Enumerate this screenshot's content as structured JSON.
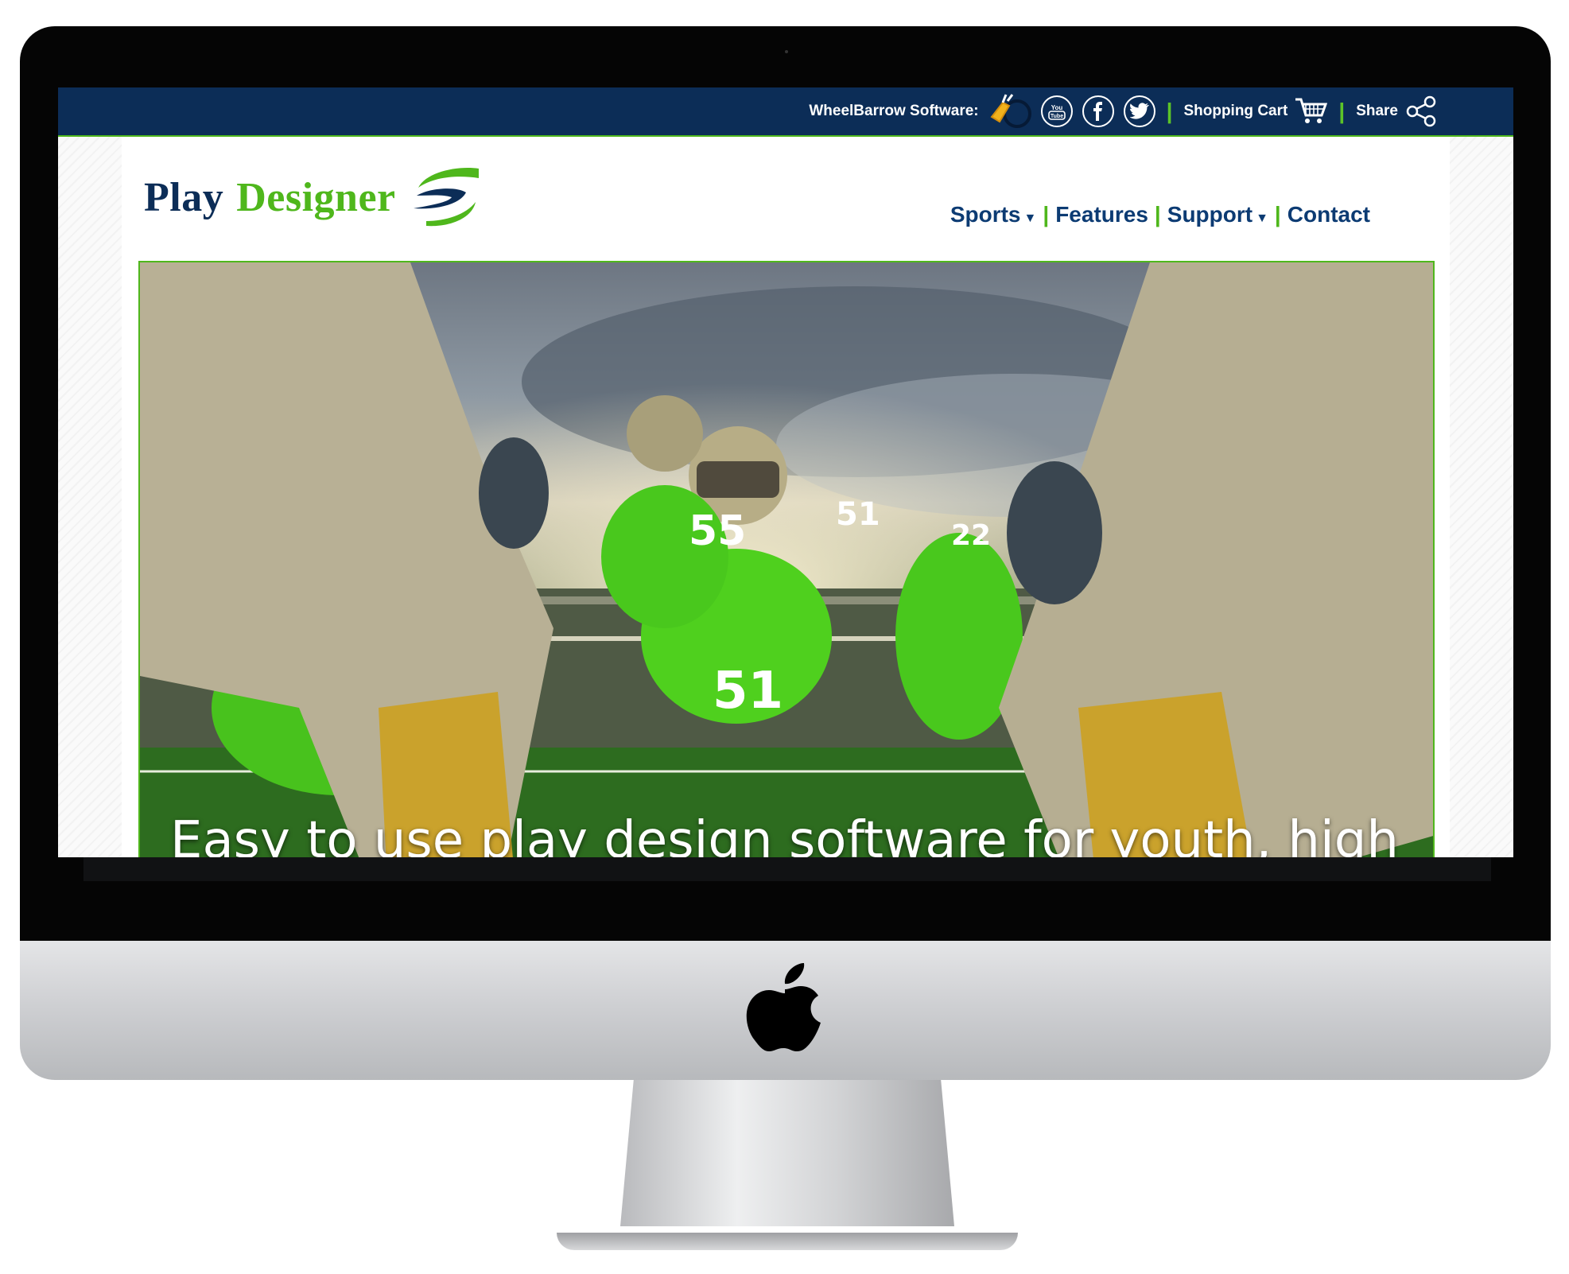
{
  "topbar": {
    "brand_label": "WheelBarrow Software:",
    "cart_label": "Shopping Cart",
    "share_label": "Share",
    "icons": [
      "wheelbarrow-icon",
      "youtube-icon",
      "facebook-icon",
      "twitter-icon",
      "cart-icon",
      "share-icon"
    ],
    "youtube_text": "You Tube"
  },
  "logo": {
    "word1": "Play",
    "word2": "Designer"
  },
  "nav": {
    "items": [
      {
        "label": "Sports",
        "dropdown": true
      },
      {
        "label": "Features",
        "dropdown": false
      },
      {
        "label": "Support",
        "dropdown": true
      },
      {
        "label": "Contact",
        "dropdown": false
      }
    ],
    "separator": "|"
  },
  "hero": {
    "title": "Easy to use play design software for youth, high",
    "jersey_numbers": [
      "55",
      "51",
      "51",
      "22"
    ]
  },
  "colors": {
    "navy": "#0c2d57",
    "green": "#4fb71c",
    "nav_text": "#0c3b73"
  }
}
